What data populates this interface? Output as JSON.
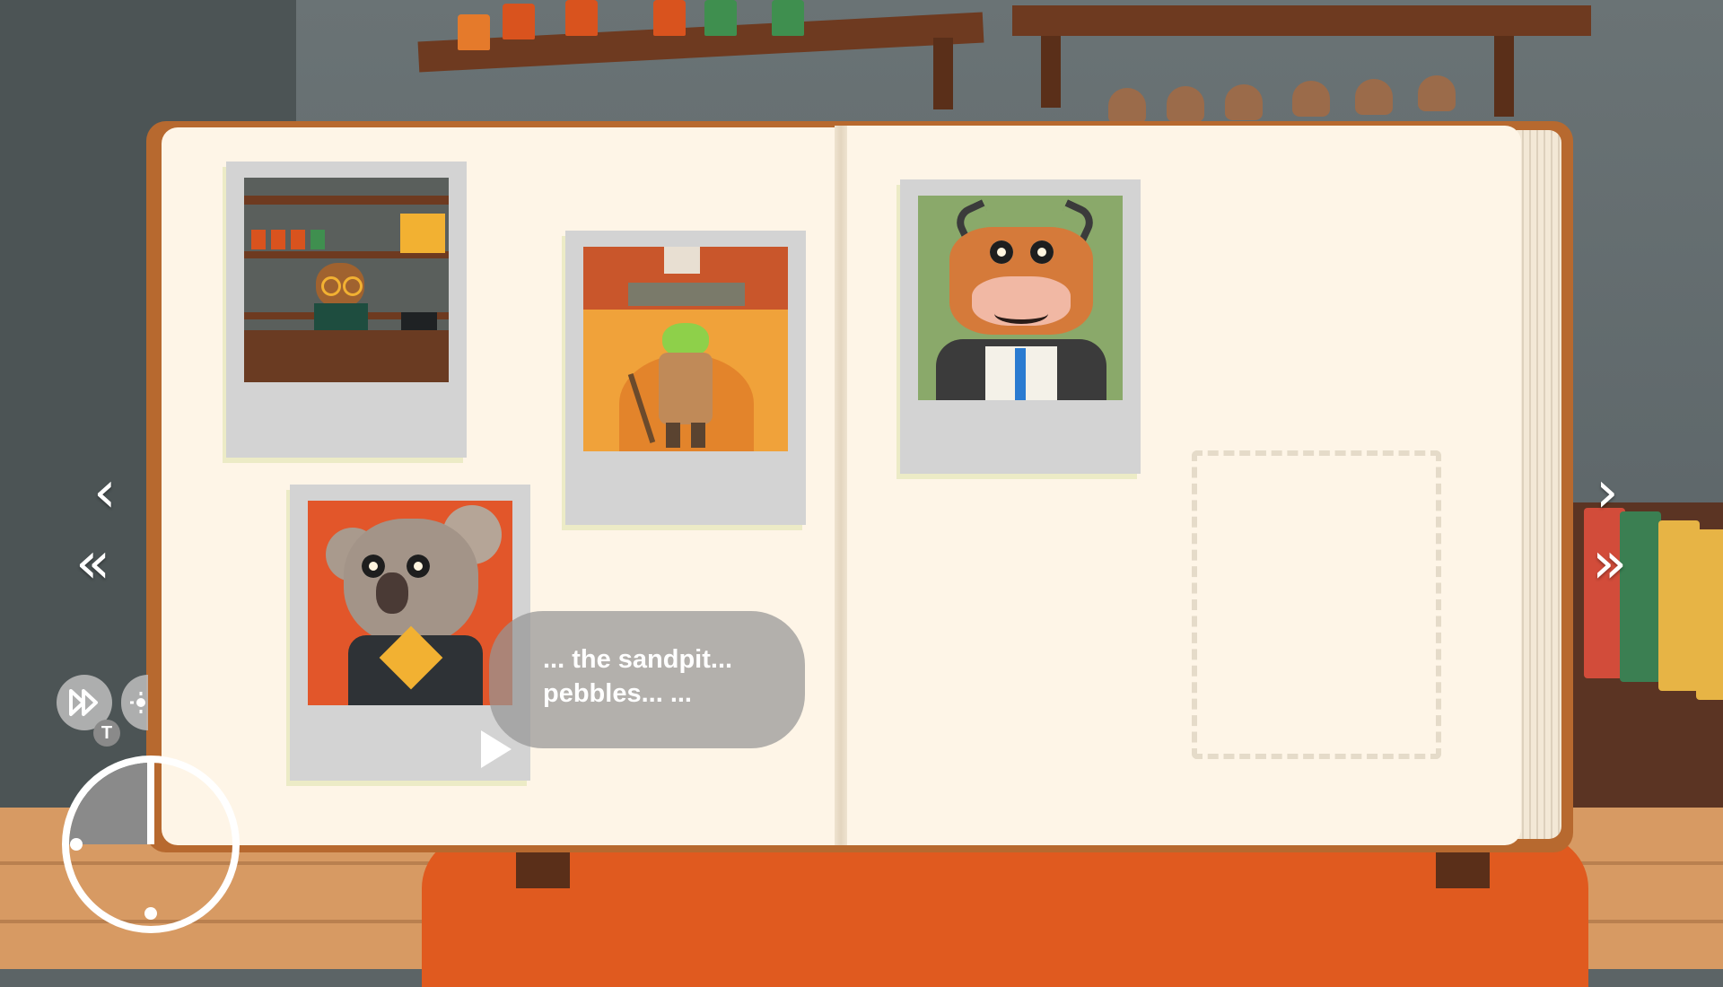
{
  "scene": {
    "title": "",
    "colors": {
      "page": "#fef5e7",
      "cover": "#b7692f",
      "polaroid": "#d3d3d3",
      "bubble": "#969696",
      "rug": "#e05a1f"
    }
  },
  "journal": {
    "photos": [
      {
        "subject": "bear shopkeeper behind counter"
      },
      {
        "subject": "frog with walking stick on desert path"
      },
      {
        "subject": "koala in front of orange curtain"
      },
      {
        "subject": "cow in shirt and tie"
      }
    ],
    "empty_slot": "dashed empty photo slot"
  },
  "dialogue": {
    "text": "... the sandpit...\npebbles... ..."
  },
  "controls": {
    "prev_page": "chevron-left-icon",
    "first_page": "double-chevron-left-icon",
    "next_page": "chevron-right-icon",
    "last_page": "double-chevron-right-icon",
    "fast_forward_icon": "fast-forward-icon",
    "fast_forward_key": "T",
    "settings_icon": "sun-icon",
    "clock_icon": "clock-icon"
  }
}
